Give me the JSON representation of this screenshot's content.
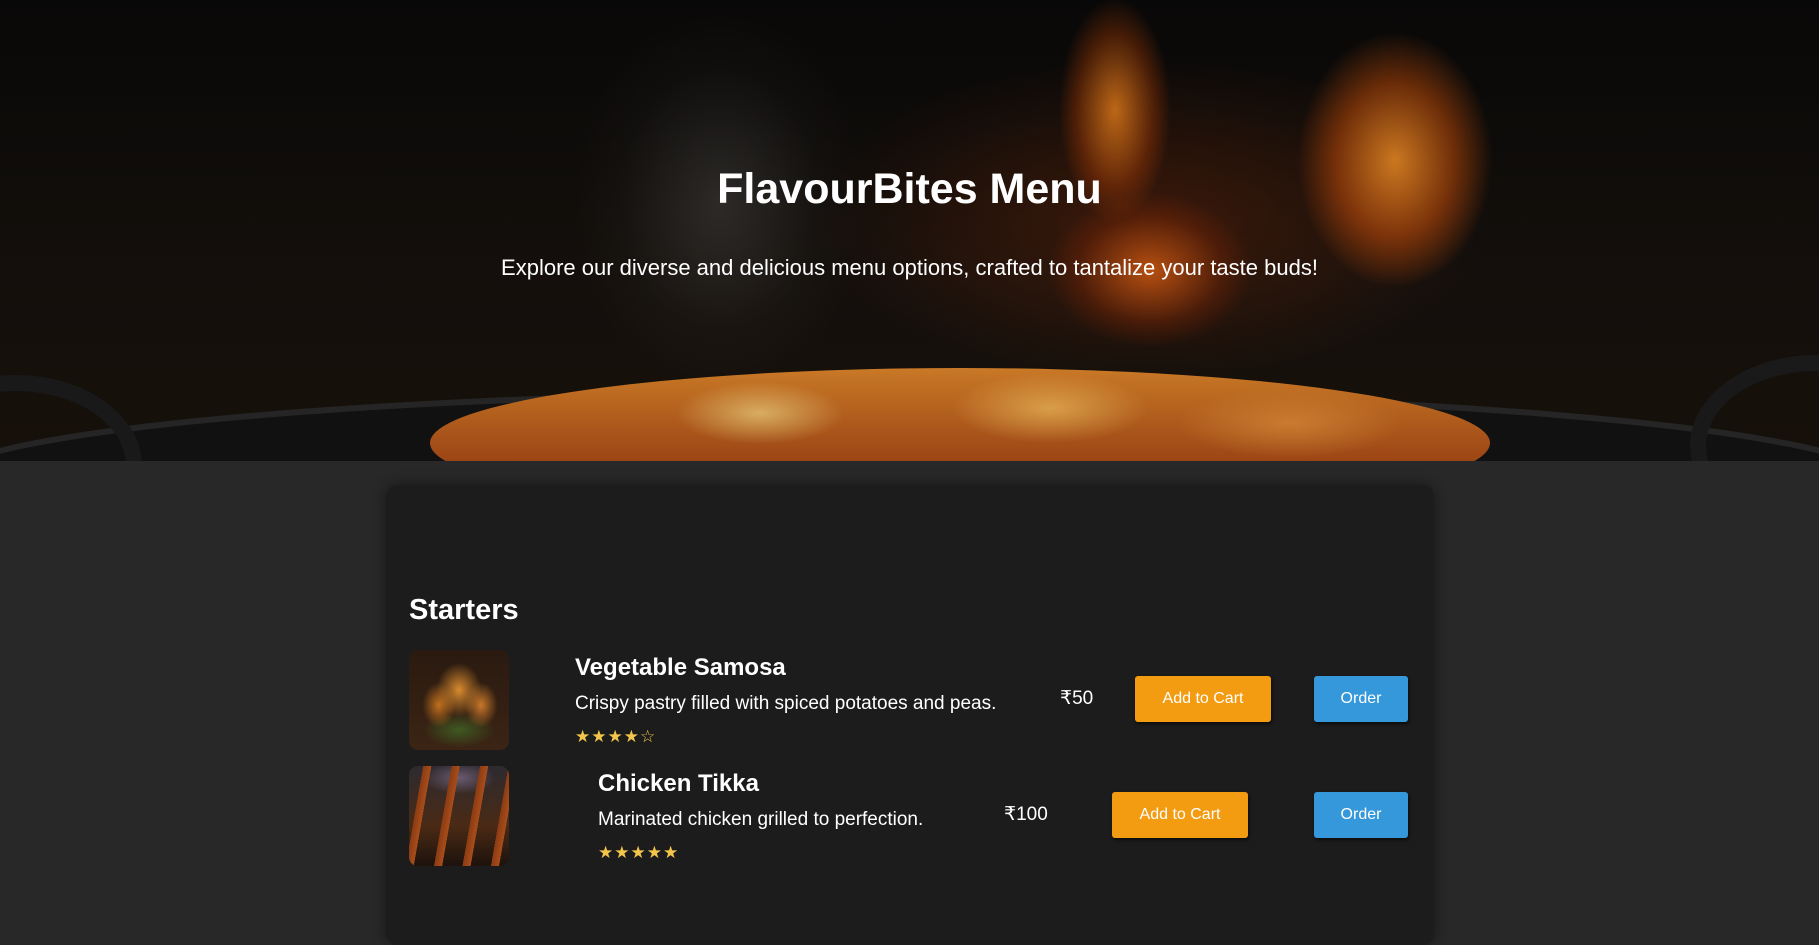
{
  "hero": {
    "title": "FlavourBites Menu",
    "subtitle": "Explore our diverse and delicious menu options, crafted to tantalize your taste buds!"
  },
  "menu": {
    "sections": [
      {
        "heading": "Starters",
        "items": [
          {
            "name": "Vegetable Samosa",
            "description": "Crispy pastry filled with spiced potatoes and peas.",
            "rating_text": "★★★★☆",
            "rating": 4,
            "price": "₹50",
            "add_to_cart_label": "Add to Cart",
            "order_label": "Order",
            "image_icon": "samosa-photo"
          },
          {
            "name": "Chicken Tikka",
            "description": "Marinated chicken grilled to perfection.",
            "rating_text": "★★★★★",
            "rating": 5,
            "price": "₹100",
            "add_to_cart_label": "Add to Cart",
            "order_label": "Order",
            "image_icon": "chicken-tikka-photo"
          }
        ]
      }
    ]
  },
  "colors": {
    "page_background": "#282828",
    "panel_background": "#1c1c1c",
    "add_to_cart": "#f39c12",
    "order": "#3498db",
    "rating_star": "#f3c64b"
  }
}
